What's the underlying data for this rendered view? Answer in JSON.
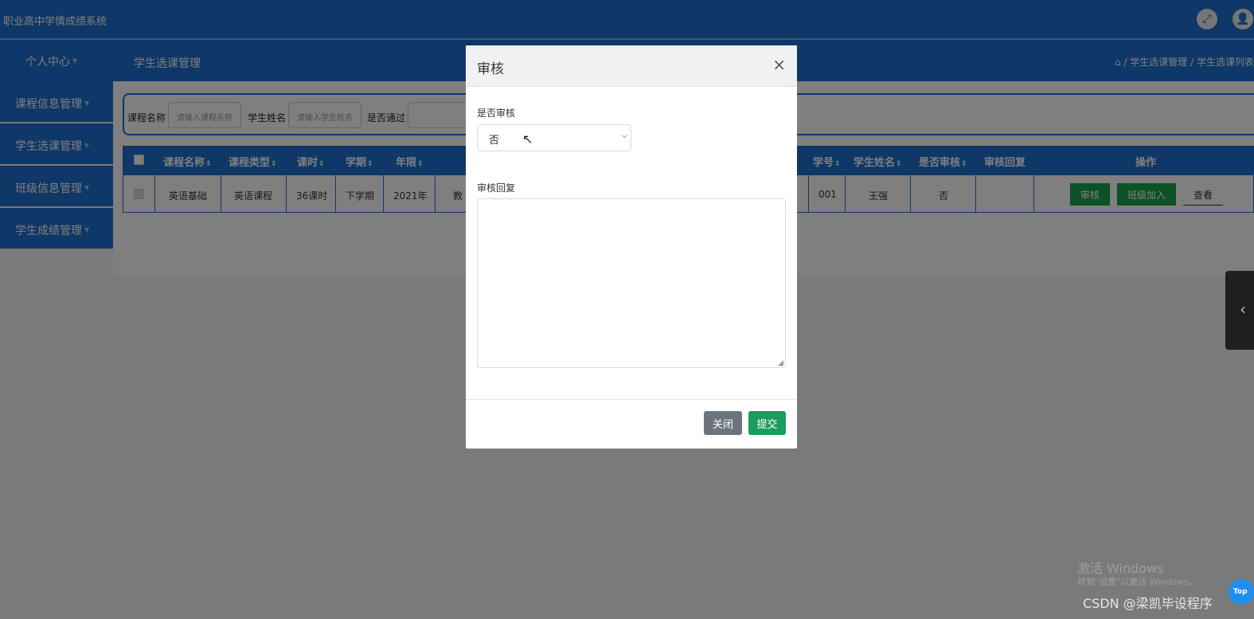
{
  "app": {
    "title": "职业高中学情成绩系统"
  },
  "nav": {
    "personal_center": "个人中心",
    "section_title": "学生选课管理",
    "breadcrumb": {
      "level1": "学生选课管理",
      "level2": "学生选课列表"
    }
  },
  "sidebar": {
    "items": [
      {
        "label": "课程信息管理"
      },
      {
        "label": "学生选课管理"
      },
      {
        "label": "班级信息管理"
      },
      {
        "label": "学生成绩管理"
      }
    ]
  },
  "search": {
    "course_name_label": "课程名称",
    "course_name_placeholder": "请输入课程名称",
    "student_name_label": "学生姓名",
    "student_name_placeholder": "请输入学生姓名",
    "passed_label": "是否通过"
  },
  "table": {
    "headers": {
      "course_name": "课程名称",
      "course_type": "课程类型",
      "hours": "课时",
      "term": "学期",
      "year": "年限",
      "student_no": "学号",
      "student_name": "学生姓名",
      "reviewed": "是否审核",
      "review_reply": "审核回复",
      "actions": "操作"
    },
    "rows": [
      {
        "course_name": "英语基础",
        "course_type": "英语课程",
        "hours": "36课时",
        "term": "下学期",
        "year": "2021年",
        "partial": "教",
        "student_no": "001",
        "student_name": "王强",
        "reviewed": "否",
        "review_reply": "",
        "btn_review": "审核",
        "btn_join_class": "班级加入",
        "btn_view": "查看"
      }
    ]
  },
  "modal": {
    "title": "审核",
    "close_glyph": "×",
    "review_label": "是否审核",
    "review_value": "否",
    "reply_label": "审核回复",
    "reply_value": "",
    "close_button": "关闭",
    "submit_button": "提交"
  },
  "watermark": {
    "line1": "激活 Windows",
    "line2": "转到\"设置\"以激活 Windows。",
    "csdn": "CSDN @梁凯毕设程序"
  },
  "top_button": "Top",
  "colors": {
    "primary": "#1e6fcf",
    "success": "#1aa34a",
    "modal_close_btn": "#6c757d",
    "modal_submit_btn": "#1a9c5c"
  }
}
